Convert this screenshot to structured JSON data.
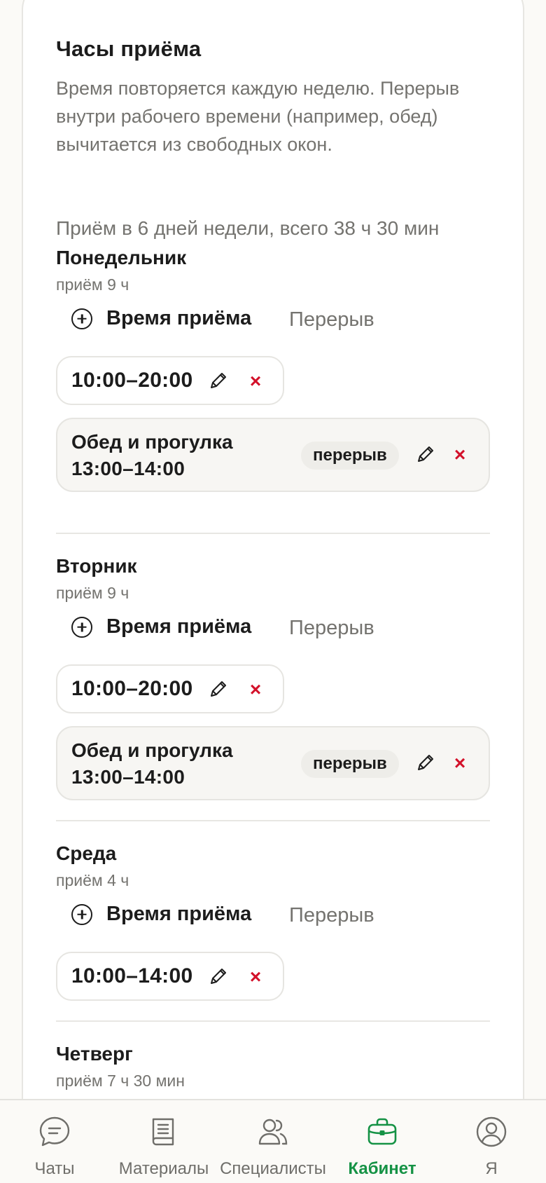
{
  "section": {
    "title": "Часы приёма",
    "description": "Время повторяется каждую неделю. Перерыв внутри рабочего времени (например, обед) вычитается из свободных окон.",
    "summary": "Приём в 6 дней недели, всего 38 ч 30 мин"
  },
  "actions": {
    "add_hours_label": "Время приёма",
    "add_break_label": "Перерыв",
    "break_badge": "перерыв"
  },
  "days": [
    {
      "name": "Понедельник",
      "subtitle": "приём 9 ч",
      "slot": "10:00–20:00",
      "break": {
        "name": "Обед и прогулка",
        "time": "13:00–14:00"
      }
    },
    {
      "name": "Вторник",
      "subtitle": "приём 9 ч",
      "slot": "10:00–20:00",
      "break": {
        "name": "Обед и прогулка",
        "time": "13:00–14:00"
      }
    },
    {
      "name": "Среда",
      "subtitle": "приём 4 ч",
      "slot": "10:00–14:00"
    },
    {
      "name": "Четверг",
      "subtitle": "приём 7 ч 30 мин"
    }
  ],
  "tabbar": {
    "items": [
      {
        "label": "Чаты",
        "icon": "chat-bubble-icon"
      },
      {
        "label": "Материалы",
        "icon": "book-icon"
      },
      {
        "label": "Специалисты",
        "icon": "people-icon"
      },
      {
        "label": "Кабинет",
        "icon": "briefcase-icon",
        "active": true
      },
      {
        "label": "Я",
        "icon": "profile-icon"
      }
    ],
    "accent": "#159245"
  },
  "colors": {
    "delete": "#d3112a",
    "muted": "#74736f"
  }
}
